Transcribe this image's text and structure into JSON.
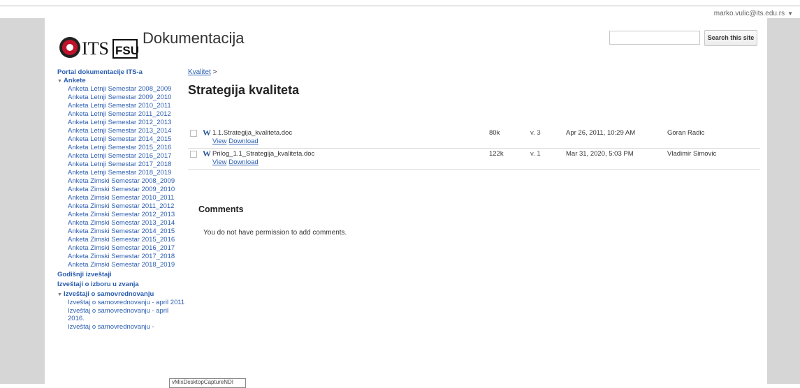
{
  "user": {
    "email": "marko.vulic@its.edu.rs"
  },
  "header": {
    "logo_text": "ITS FSU",
    "title": "Dokumentacija",
    "search_button": "Search this site"
  },
  "nav": {
    "portal": "Portal dokumentacije ITS-a",
    "ankete": "Ankete",
    "ankete_items": [
      "Anketa Letnji Semestar 2008_2009",
      "Anketa Letnji Semestar 2009_2010",
      "Anketa Letnji Semestar 2010_2011",
      "Anketa Letnji Semestar 2011_2012",
      "Anketa Letnji Semestar 2012_2013",
      "Anketa Letnji Semestar 2013_2014",
      "Anketa Letnji Semestar 2014_2015",
      "Anketa Letnji Semestar 2015_2016",
      "Anketa Letnji Semestar 2016_2017",
      "Anketa Letnji Semestar 2017_2018",
      "Anketa Letnji Semestar 2018_2019",
      "Anketa Zimski Semestar 2008_2009",
      "Anketa Zimski Semestar 2009_2010",
      "Anketa Zimski Semestar 2010_2011",
      "Anketa Zimski Semestar 2011_2012",
      "Anketa Zimski Semestar 2012_2013",
      "Anketa Zimski Semestar 2013_2014",
      "Anketa Zimski Semestar 2014_2015",
      "Anketa Zimski Semestar 2015_2016",
      "Anketa Zimski Semestar 2016_2017",
      "Anketa Zimski Semestar 2017_2018",
      "Anketa Zimski Semestar 2018_2019"
    ],
    "godisnji": "Godišnji izveštaji",
    "izbor": "Izveštaji o izboru u zvanja",
    "samovrednovanje": "Izveštaji o samovrednovanju",
    "sam_items": [
      "Izveštaj o samovrednovanju - april 2011",
      "Izveštaj o samovrednovanju - april 2016.",
      "Izveštaj o samovrednovanju -"
    ]
  },
  "main": {
    "breadcrumb_link": "Kvalitet",
    "breadcrumb_sep": ">",
    "title": "Strategija kvaliteta",
    "view_label": "View",
    "download_label": "Download",
    "files": [
      {
        "name": "1.1.Strategija_kvaliteta.doc",
        "size": "80k",
        "version": "v. 3",
        "date": "Apr 26, 2011, 10:29 AM",
        "author": "Goran Radic"
      },
      {
        "name": "Prilog_1.1_Strategija_kvaliteta.doc",
        "size": "122k",
        "version": "v. 1",
        "date": "Mar 31, 2020, 5:03 PM",
        "author": "Vladimir Simovic"
      }
    ],
    "comments_title": "Comments",
    "comments_note": "You do not have permission to add comments."
  },
  "tooltip": "vMixDesktopCaptureNDI"
}
